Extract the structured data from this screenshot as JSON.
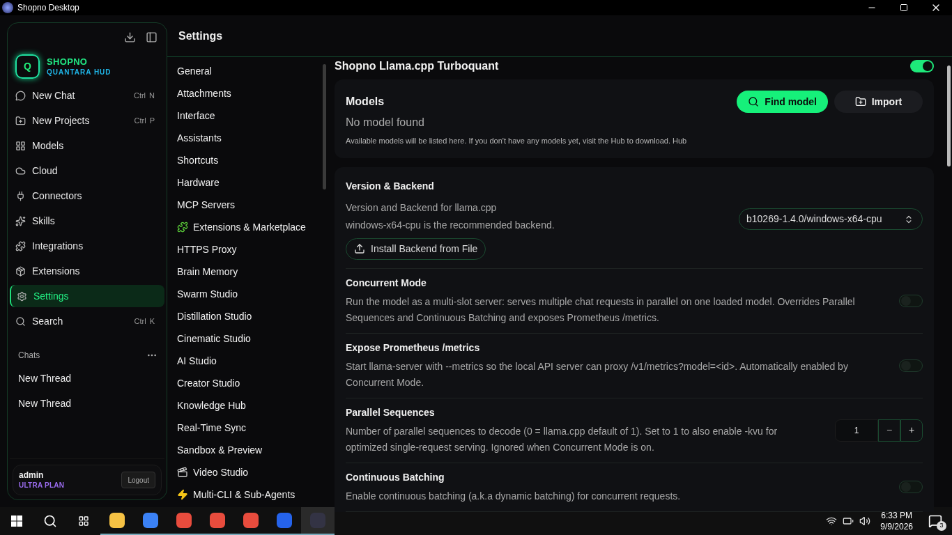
{
  "window": {
    "title": "Shopno Desktop"
  },
  "sidebar": {
    "brand": {
      "logo_letter": "Q",
      "name": "SHOPNO",
      "subtitle": "QUANTARA HUD"
    },
    "items": [
      {
        "label": "New Chat",
        "shortcut": [
          "Ctrl",
          "N"
        ],
        "selected": false
      },
      {
        "label": "New Projects",
        "shortcut": [
          "Ctrl",
          "P"
        ],
        "selected": false
      },
      {
        "label": "Models",
        "selected": false
      },
      {
        "label": "Cloud",
        "selected": false
      },
      {
        "label": "Connectors",
        "selected": false
      },
      {
        "label": "Skills",
        "selected": false
      },
      {
        "label": "Integrations",
        "selected": false
      },
      {
        "label": "Extensions",
        "selected": false
      },
      {
        "label": "Settings",
        "selected": true
      },
      {
        "label": "Search",
        "shortcut": [
          "Ctrl",
          "K"
        ],
        "selected": false
      }
    ],
    "chats": {
      "title": "Chats",
      "threads": [
        "New Thread",
        "New Thread"
      ]
    },
    "user": {
      "name": "admin",
      "plan": "ULTRA PLAN",
      "logout": "Logout"
    }
  },
  "header": {
    "title": "Settings"
  },
  "settings_nav": [
    {
      "label": "General",
      "selected": false
    },
    {
      "label": "Attachments",
      "selected": false
    },
    {
      "label": "Interface",
      "selected": false
    },
    {
      "label": "Assistants",
      "selected": false
    },
    {
      "label": "Shortcuts",
      "selected": false
    },
    {
      "label": "Hardware",
      "selected": false
    },
    {
      "label": "MCP Servers",
      "selected": false
    },
    {
      "label": "Extensions & Marketplace",
      "selected": false
    },
    {
      "label": "HTTPS Proxy",
      "selected": false
    },
    {
      "label": "Brain Memory",
      "selected": false
    },
    {
      "label": "Swarm Studio",
      "selected": false
    },
    {
      "label": "Distillation Studio",
      "selected": false
    },
    {
      "label": "Cinematic Studio",
      "selected": false
    },
    {
      "label": "AI Studio",
      "selected": false
    },
    {
      "label": "Creator Studio",
      "selected": false
    },
    {
      "label": "Knowledge Hub",
      "selected": false
    },
    {
      "label": "Real-Time Sync",
      "selected": false
    },
    {
      "label": "Sandbox & Preview",
      "selected": false
    },
    {
      "label": "Video Studio",
      "selected": false
    },
    {
      "label": "Multi-CLI & Sub-Agents",
      "selected": false
    }
  ],
  "provider": {
    "title": "Shopno Llama.cpp Turboquant",
    "on": true
  },
  "models": {
    "title": "Models",
    "find_button": "Find model",
    "import_button": "Import",
    "empty_title": "No model found",
    "empty_text": "Available models will be listed here. If you don't have any models yet, visit the Hub to download. Hub"
  },
  "backend": {
    "title": "Version & Backend",
    "lines": [
      "Version and Backend for llama.cpp",
      "windows-x64-cpu is the recommended backend."
    ],
    "install_button": "Install Backend from File",
    "version": "b10269-1.4.0/windows-x64-cpu"
  },
  "options": [
    {
      "kind": "toggle",
      "title": "Concurrent Mode",
      "description": "Run the model as a multi-slot server: serves multiple chat requests in parallel on one loaded model. Overrides Parallel Sequences and Continuous Batching and exposes Prometheus /metrics.",
      "on": false
    },
    {
      "kind": "toggle",
      "title": "Expose Prometheus /metrics",
      "description": "Start llama-server with --metrics so the local API server can proxy /v1/metrics?model=<id>. Automatically enabled by Concurrent Mode.",
      "on": false
    },
    {
      "kind": "number",
      "title": "Parallel Sequences",
      "description": "Number of parallel sequences to decode (0 = llama.cpp default of 1). Set to 1 to also enable -kvu for optimized single-request serving. Ignored when Concurrent Mode is on.",
      "value": "1",
      "minus": "−",
      "plus": "+"
    },
    {
      "kind": "toggle",
      "title": "Continuous Batching",
      "description": "Enable continuous batching (a.k.a dynamic batching) for concurrent requests.",
      "on": false
    }
  ],
  "taskbar": {
    "time": "6:33 PM",
    "date": "9/9/2026",
    "notifications": "3"
  }
}
